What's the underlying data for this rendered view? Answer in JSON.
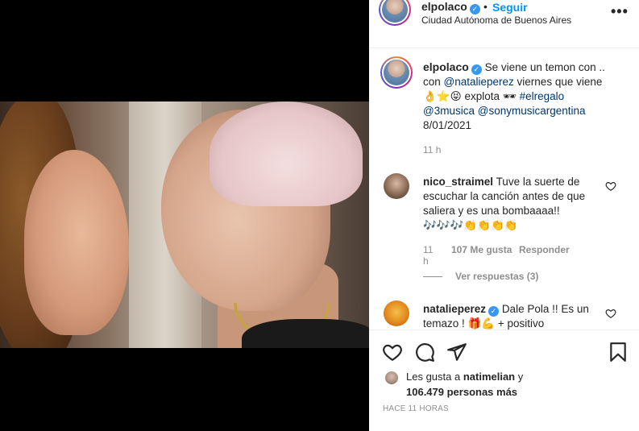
{
  "header": {
    "username": "elpolaco",
    "separator": "•",
    "follow_label": "Seguir",
    "location": "Ciudad Autónoma de Buenos Aires",
    "more_label": "•••"
  },
  "caption": {
    "username": "elpolaco",
    "text_1": "Se viene un temon con ..",
    "text_2": "con ",
    "mention_1": "@natalieperez",
    "text_3": " viernes que viene",
    "text_4": "👌⭐😝 explota 🕶 ",
    "hashtag": "#elregalo",
    "mention_2": "@3musica",
    "mention_3": "@sonymusicargentina",
    "date": "8/01/2021",
    "time": "11 h"
  },
  "comments": [
    {
      "username": "nico_straimel",
      "line_1": "Tuve la suerte de",
      "line_2": "escuchar la canción antes de que",
      "line_3": "saliera y es una bombaaaa!!",
      "line_4": "🎶🎶🎶👏👏👏👏",
      "time": "11 h",
      "likes": "107 Me gusta",
      "reply": "Responder",
      "view_replies": "Ver respuestas (3)"
    },
    {
      "username": "natalieperez",
      "line_1": "Dale Pola !! Es un",
      "line_2": "temazo ! 🎁💪 + positivo"
    }
  ],
  "likes": {
    "prefix": "Les gusta a ",
    "user": "natimelian",
    "connector": " y",
    "count": "106.479 personas más"
  },
  "time_ago": "HACE 11 HORAS",
  "colors": {
    "accent": "#0095f6",
    "verified": "#3897f0",
    "mention": "#00376b",
    "muted": "#8e8e8e"
  },
  "icons": {
    "like": "heart-icon",
    "comment": "comment-icon",
    "share": "paper-plane-icon",
    "save": "bookmark-icon",
    "more": "more-dots-icon"
  }
}
